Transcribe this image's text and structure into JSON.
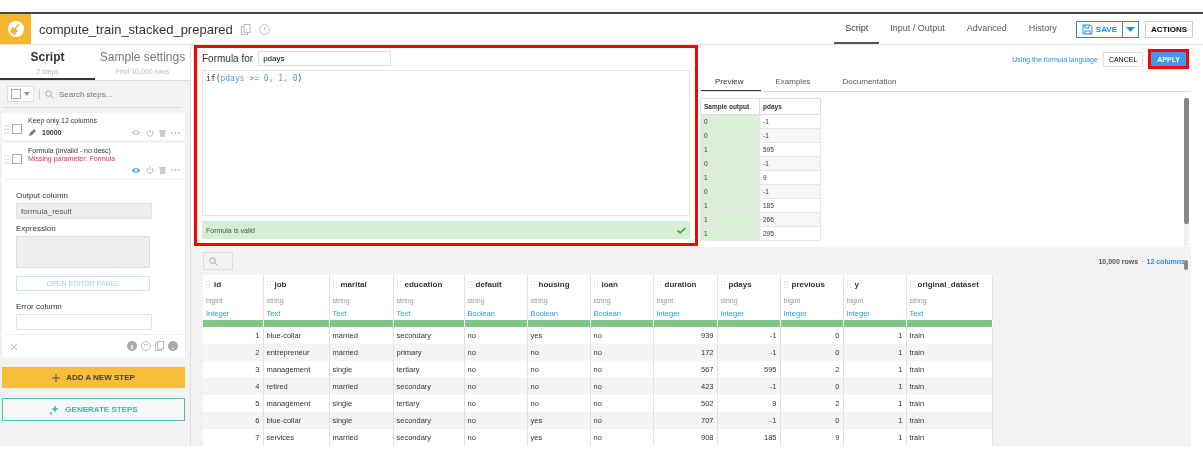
{
  "header": {
    "title": "compute_train_stacked_prepared",
    "tabs": [
      {
        "label": "Script",
        "selected": true
      },
      {
        "label": "Input / Output",
        "selected": false
      },
      {
        "label": "Advanced",
        "selected": false
      },
      {
        "label": "History",
        "selected": false
      }
    ],
    "save": "SAVE",
    "actions": "ACTIONS"
  },
  "sidebar": {
    "tabs": [
      {
        "label": "Script",
        "sub": "2 steps",
        "selected": true
      },
      {
        "label": "Sample settings",
        "sub": "First 10,000 rows",
        "selected": false
      }
    ],
    "search_placeholder": "Search steps...",
    "steps": [
      {
        "title": "Keep only 12 columns",
        "meta": "10000",
        "expanded": false
      },
      {
        "title": "Formula (invalid - no desc)",
        "error": "Missing parameter: Formula",
        "expanded": true
      }
    ],
    "form": {
      "output_label": "Output column",
      "output_value": "formula_result",
      "expression_label": "Expression",
      "open_editor": "OPEN EDITOR PANEL",
      "error_label": "Error column"
    },
    "add_step": "ADD A NEW STEP",
    "generate": "GENERATE STEPS"
  },
  "editor": {
    "label": "Formula for",
    "column": "pdays",
    "code": [
      {
        "text": "if(",
        "kind": "fn"
      },
      {
        "text": "pdays",
        "kind": "var"
      },
      {
        "text": " >= ",
        "kind": "op"
      },
      {
        "text": "0",
        "kind": "num"
      },
      {
        "text": ", ",
        "kind": "op"
      },
      {
        "text": "1",
        "kind": "num"
      },
      {
        "text": ", ",
        "kind": "op"
      },
      {
        "text": "0",
        "kind": "num"
      },
      {
        "text": ")",
        "kind": "fn"
      }
    ],
    "status": "Formula is valid",
    "valid": true
  },
  "help": {
    "link": "Using the formula language",
    "cancel": "CANCEL",
    "apply": "APPLY",
    "tabs": [
      {
        "label": "Preview",
        "selected": true
      },
      {
        "label": "Examples",
        "selected": false
      },
      {
        "label": "Documentation",
        "selected": false
      }
    ],
    "columns": [
      "Sample output",
      "pdays"
    ],
    "rows": [
      [
        "0",
        "-1"
      ],
      [
        "0",
        "-1"
      ],
      [
        "1",
        "595"
      ],
      [
        "0",
        "-1"
      ],
      [
        "1",
        "9"
      ],
      [
        "0",
        "-1"
      ],
      [
        "1",
        "185"
      ],
      [
        "1",
        "266"
      ],
      [
        "1",
        "295"
      ]
    ]
  },
  "grid": {
    "rows_count": "10,000 rows",
    "separator": "·",
    "columns_count": "12 columns",
    "columns": [
      {
        "name": "id",
        "storage": "bigint",
        "meaning": "Integer",
        "numeric": true
      },
      {
        "name": "job",
        "storage": "string",
        "meaning": "Text",
        "numeric": false
      },
      {
        "name": "marital",
        "storage": "string",
        "meaning": "Text",
        "numeric": false
      },
      {
        "name": "education",
        "storage": "string",
        "meaning": "Text",
        "numeric": false
      },
      {
        "name": "default",
        "storage": "string",
        "meaning": "Boolean",
        "numeric": false
      },
      {
        "name": "housing",
        "storage": "string",
        "meaning": "Boolean",
        "numeric": false
      },
      {
        "name": "loan",
        "storage": "string",
        "meaning": "Boolean",
        "numeric": false
      },
      {
        "name": "duration",
        "storage": "bigint",
        "meaning": "Integer",
        "numeric": true
      },
      {
        "name": "pdays",
        "storage": "string",
        "meaning": "Integer",
        "numeric": true
      },
      {
        "name": "previous",
        "storage": "bigint",
        "meaning": "Integer",
        "numeric": true
      },
      {
        "name": "y",
        "storage": "bigint",
        "meaning": "Integer",
        "numeric": true
      },
      {
        "name": "original_dataset",
        "storage": "string",
        "meaning": "Text",
        "numeric": false
      }
    ],
    "rows": [
      [
        "1",
        "blue-collar",
        "married",
        "secondary",
        "no",
        "yes",
        "no",
        "939",
        "-1",
        "0",
        "1",
        "train"
      ],
      [
        "2",
        "entrepreneur",
        "married",
        "primary",
        "no",
        "no",
        "no",
        "172",
        "-1",
        "0",
        "1",
        "train"
      ],
      [
        "3",
        "management",
        "single",
        "tertiary",
        "no",
        "no",
        "no",
        "567",
        "595",
        "2",
        "1",
        "train"
      ],
      [
        "4",
        "retired",
        "married",
        "secondary",
        "no",
        "no",
        "no",
        "423",
        "-1",
        "0",
        "1",
        "train"
      ],
      [
        "5",
        "management",
        "single",
        "tertiary",
        "no",
        "no",
        "no",
        "502",
        "9",
        "2",
        "1",
        "train"
      ],
      [
        "6",
        "blue-collar",
        "single",
        "secondary",
        "no",
        "yes",
        "no",
        "707",
        "-1",
        "0",
        "1",
        "train"
      ],
      [
        "7",
        "services",
        "married",
        "secondary",
        "no",
        "yes",
        "no",
        "908",
        "185",
        "9",
        "1",
        "train"
      ]
    ]
  }
}
